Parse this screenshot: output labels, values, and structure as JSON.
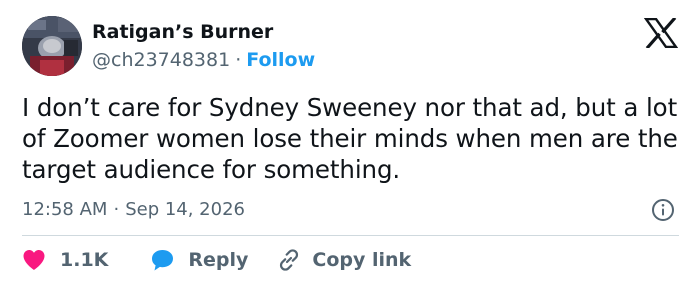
{
  "author": {
    "display_name": "Ratigan’s Burner",
    "handle": "@ch23748381",
    "follow_label": "Follow"
  },
  "tweet": {
    "text": "I don’t care for Sydney Sweeney nor that ad, but a lot of Zoomer women lose their minds when men are the target audience for something.",
    "time": "12:58 AM",
    "date": "Sep 14, 2026"
  },
  "actions": {
    "like_count": "1.1K",
    "reply_label": "Reply",
    "copy_link_label": "Copy link"
  },
  "icons": {
    "brand": "x-logo-icon",
    "info": "info-icon",
    "like": "heart-icon",
    "reply": "speech-bubble-icon",
    "copy": "link-icon"
  },
  "colors": {
    "text": "#0f1419",
    "secondary_text": "#536471",
    "accent": "#1d9bf0",
    "like": "#f91880",
    "divider": "#cfd9de"
  }
}
